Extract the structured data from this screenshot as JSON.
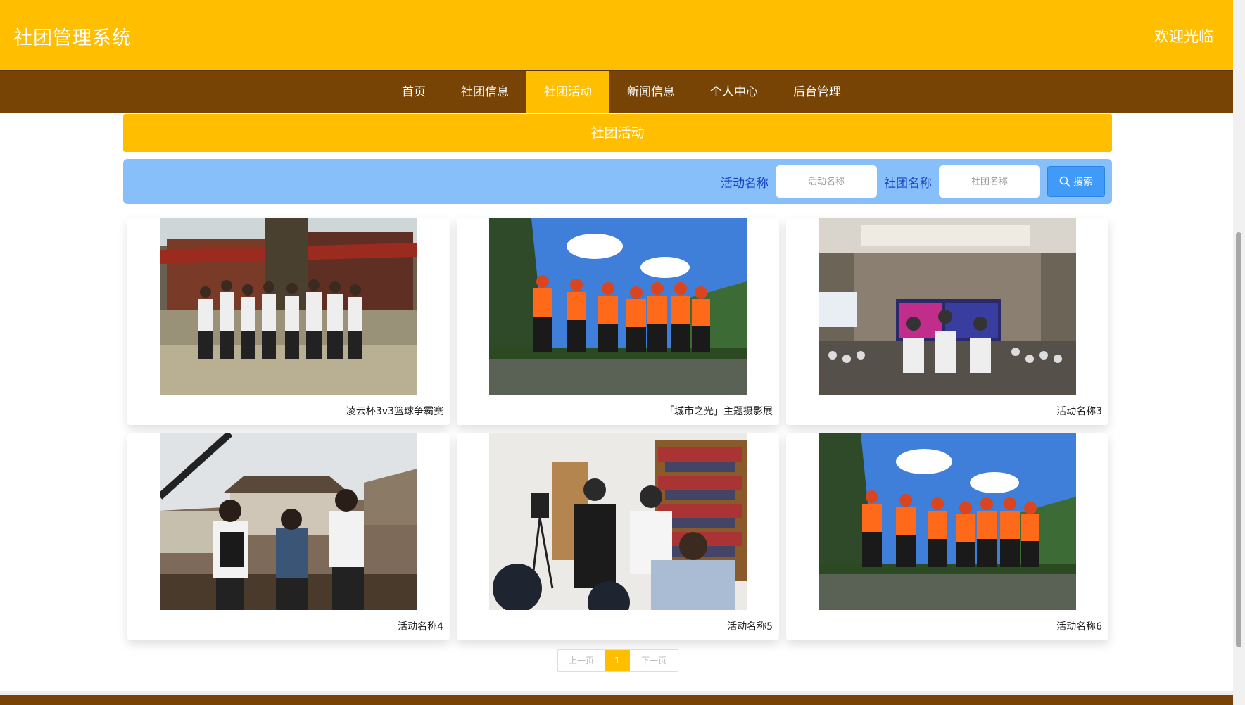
{
  "header": {
    "title": "社团管理系统",
    "welcome": "欢迎光临"
  },
  "nav": {
    "items": [
      {
        "label": "首页"
      },
      {
        "label": "社团信息"
      },
      {
        "label": "社团活动"
      },
      {
        "label": "新闻信息"
      },
      {
        "label": "个人中心"
      },
      {
        "label": "后台管理"
      }
    ],
    "active": "社团活动"
  },
  "section": {
    "title": "社团活动"
  },
  "search": {
    "activity_label": "活动名称",
    "activity_placeholder": "活动名称",
    "club_label": "社团名称",
    "club_placeholder": "社团名称",
    "button_label": "搜索"
  },
  "activities": [
    {
      "caption": "凌云杯3v3篮球争霸赛",
      "photo": "group-temple"
    },
    {
      "caption": "「城市之光」主题摄影展",
      "photo": "rafting-group"
    },
    {
      "caption": "活动名称3",
      "photo": "conference-hall"
    },
    {
      "caption": "活动名称4",
      "photo": "old-town-trio"
    },
    {
      "caption": "活动名称5",
      "photo": "library-demo"
    },
    {
      "caption": "活动名称6",
      "photo": "rafting-group"
    }
  ],
  "pagination": {
    "prev": "上一页",
    "current": "1",
    "next": "下一页"
  },
  "colors": {
    "primary": "#FFBF00",
    "nav": "#774405",
    "search_bar": "#87BFFB",
    "search_button": "#3F9AF8",
    "search_label": "#1A3FC4"
  }
}
